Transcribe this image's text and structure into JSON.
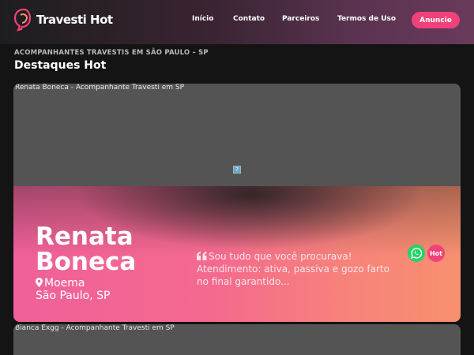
{
  "header": {
    "logo_text": "Travesti Hot",
    "nav": {
      "inicio": "Início",
      "contato": "Contato",
      "parceiros": "Parceiros",
      "termos": "Termos de Uso"
    },
    "cta": "Anuncie"
  },
  "section": {
    "kicker": "ACOMPANHANTES TRAVESTIS EM SÃO PAULO – SP",
    "title": "Destaques Hot"
  },
  "cards": [
    {
      "alt": "Renata Boneca - Acompanhante Travesti em SP",
      "name": "Renata Boneca",
      "neighborhood": "Moema",
      "city": "São Paulo, SP",
      "quote": "Sou tudo que você procurava! Atendimento: ativa, passiva e gozo farto no final garantido...",
      "badge": "Hot"
    },
    {
      "alt": "Bianca Exgg - Acompanhante Travesti em SP"
    }
  ],
  "colors": {
    "accent": "#f0427a",
    "whatsapp": "#25d366",
    "background": "#141414"
  },
  "icons": {
    "logo": "woman-profile-icon",
    "location": "map-pin-icon",
    "quote": "quote-icon",
    "whatsapp": "whatsapp-icon"
  }
}
